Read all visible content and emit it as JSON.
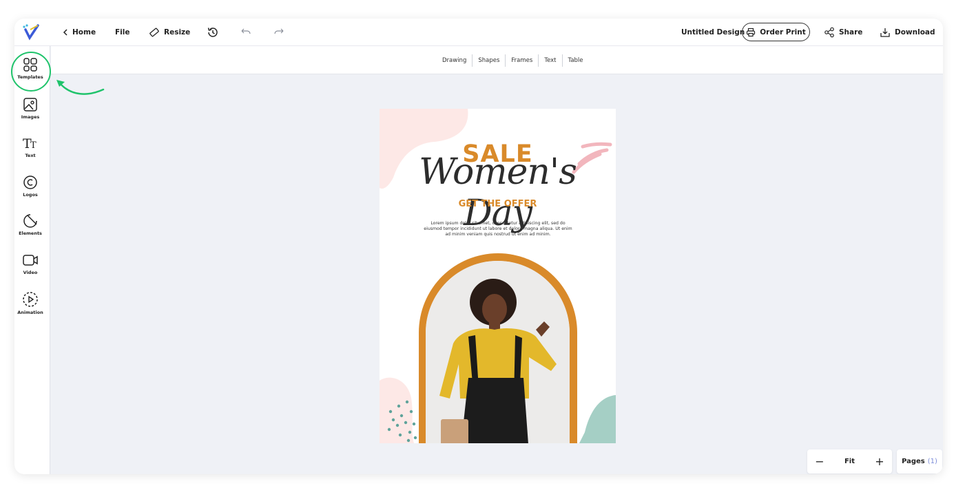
{
  "topbar": {
    "home_label": "Home",
    "file_label": "File",
    "resize_label": "Resize",
    "design_title": "Untitled Design",
    "order_print_label": "Order Print",
    "share_label": "Share",
    "download_label": "Download"
  },
  "subbar": {
    "tabs": [
      "Drawing",
      "Shapes",
      "Frames",
      "Text",
      "Table"
    ]
  },
  "sidebar": {
    "items": [
      {
        "label": "Templates",
        "icon": "templates-icon"
      },
      {
        "label": "Images",
        "icon": "image-icon"
      },
      {
        "label": "Text",
        "icon": "text-icon"
      },
      {
        "label": "Logos",
        "icon": "copyright-icon"
      },
      {
        "label": "Elements",
        "icon": "elements-icon"
      },
      {
        "label": "Video",
        "icon": "video-icon"
      },
      {
        "label": "Animation",
        "icon": "animation-icon"
      }
    ]
  },
  "canvas": {
    "sale": "SALE",
    "title": "Women's Day",
    "offer": "GET THE OFFER",
    "body": "Lorem ipsum dolor sit amet, consectetur adipiscing elit, sed do eiusmod tempor incididunt ut labore et dolore magna aliqua. Ut enim ad minim veniam quis nostrud ut enim ad minim."
  },
  "zoom": {
    "minus": "−",
    "value": "Fit",
    "plus": "+"
  },
  "pages": {
    "label": "Pages",
    "count": "(1)"
  },
  "colors": {
    "accent_orange": "#d98a2a",
    "highlight_green": "#1fc36b",
    "canvas_bg": "#eff1f6"
  }
}
